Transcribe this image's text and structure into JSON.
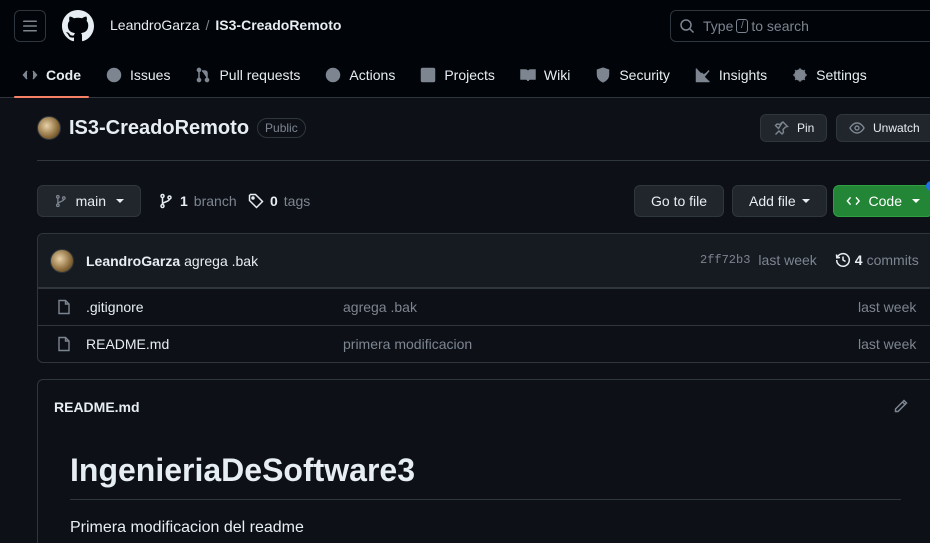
{
  "header": {
    "owner": "LeandroGarza",
    "separator": "/",
    "repo": "IS3-CreadoRemoto",
    "search": {
      "prefix": "Type",
      "key": "/",
      "suffix": "to search"
    }
  },
  "tabs": [
    {
      "label": "Code",
      "icon": "code-icon",
      "active": true
    },
    {
      "label": "Issues",
      "icon": "issue-icon"
    },
    {
      "label": "Pull requests",
      "icon": "pull-request-icon"
    },
    {
      "label": "Actions",
      "icon": "play-icon"
    },
    {
      "label": "Projects",
      "icon": "table-icon"
    },
    {
      "label": "Wiki",
      "icon": "book-icon"
    },
    {
      "label": "Security",
      "icon": "shield-icon"
    },
    {
      "label": "Insights",
      "icon": "graph-icon"
    },
    {
      "label": "Settings",
      "icon": "gear-icon"
    }
  ],
  "repo_header": {
    "name": "IS3-CreadoRemoto",
    "visibility": "Public",
    "pin_label": "Pin",
    "unwatch_label": "Unwatch"
  },
  "toolbar": {
    "branch": "main",
    "branch_count": "1",
    "branch_word": "branch",
    "tag_count": "0",
    "tag_word": "tags",
    "go_to_file": "Go to file",
    "add_file": "Add file",
    "code": "Code"
  },
  "latest_commit": {
    "author": "LeandroGarza",
    "message": "agrega .bak",
    "sha": "2ff72b3",
    "when": "last week",
    "commit_count": "4",
    "commit_word": "commits"
  },
  "files": [
    {
      "name": ".gitignore",
      "message": "agrega .bak",
      "when": "last week"
    },
    {
      "name": "README.md",
      "message": "primera modificacion",
      "when": "last week"
    }
  ],
  "readme": {
    "filename": "README.md",
    "heading": "IngenieriaDeSoftware3",
    "body": "Primera modificacion del readme"
  },
  "colors": {
    "background": "#0d1117",
    "header": "#010409",
    "border": "#30363d",
    "accent_underline": "#f78166",
    "green_button": "#238636",
    "muted_text": "#7d8590"
  }
}
